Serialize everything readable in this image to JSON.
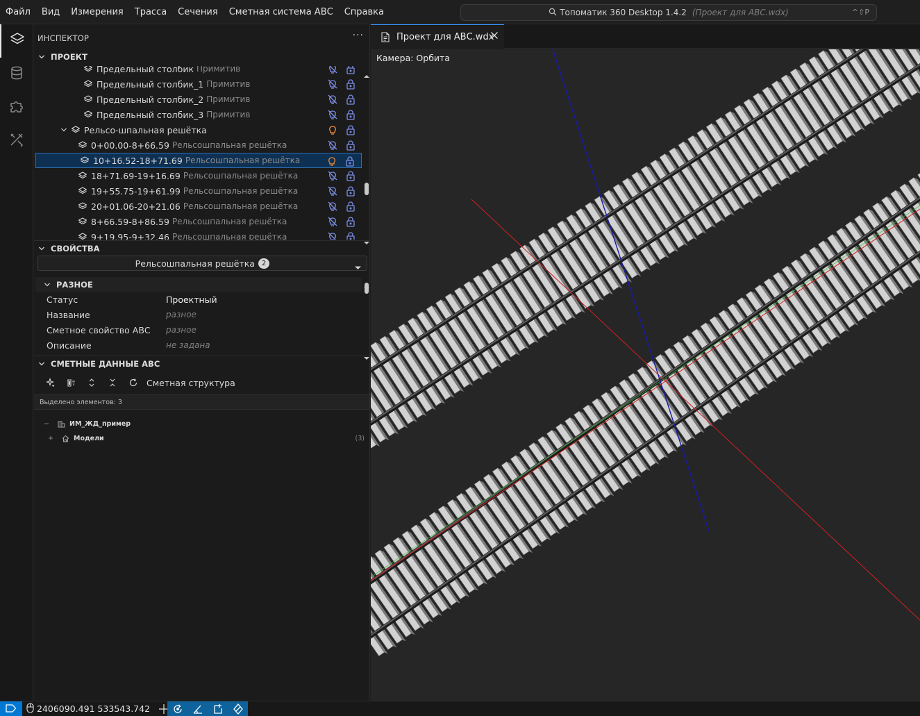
{
  "menu": [
    "Файл",
    "Вид",
    "Измерения",
    "Трасса",
    "Сечения",
    "Сметная система АВС",
    "Справка"
  ],
  "command_center": {
    "title": "Топоматик 360 Desktop 1.4.2",
    "project": "(Проект для АВС.wdx)",
    "shortcut": "^⇧P"
  },
  "activity_icons": [
    "layers-icon",
    "database-icon",
    "puzzle-icon",
    "tools-icon"
  ],
  "sidebar": {
    "title": "ИНСПЕКТОР",
    "more": "···",
    "project_section": "ПРОЕКТ",
    "tree": [
      {
        "name": "Предельный столбик",
        "type": "Примитив",
        "level": 2,
        "vis": "off"
      },
      {
        "name": "Предельный столбик_1",
        "type": "Примитив",
        "level": 2,
        "vis": "off"
      },
      {
        "name": "Предельный столбик_2",
        "type": "Примитив",
        "level": 2,
        "vis": "off"
      },
      {
        "name": "Предельный столбик_3",
        "type": "Примитив",
        "level": 2,
        "vis": "off"
      },
      {
        "name": "Рельсо-шпальная решётка",
        "type": "",
        "level": 1,
        "vis": "on",
        "expanded": true
      },
      {
        "name": "0+00.00-8+66.59",
        "type": "Рельсошпальная решётка",
        "level": 3,
        "vis": "off"
      },
      {
        "name": "10+16.52-18+71.69",
        "type": "Рельсошпальная решётка",
        "level": 3,
        "vis": "on",
        "selected": true
      },
      {
        "name": "18+71.69-19+16.69",
        "type": "Рельсошпальная решётка",
        "level": 3,
        "vis": "off"
      },
      {
        "name": "19+55.75-19+61.99",
        "type": "Рельсошпальная решётка",
        "level": 3,
        "vis": "off"
      },
      {
        "name": "20+01.06-20+21.06",
        "type": "Рельсошпальная решётка",
        "level": 3,
        "vis": "off"
      },
      {
        "name": "8+66.59-8+86.59",
        "type": "Рельсошпальная решётка",
        "level": 3,
        "vis": "off"
      },
      {
        "name": "9+19.95-9+32.46",
        "type": "Рельсошпальная решётка",
        "level": 3,
        "vis": "off"
      }
    ],
    "properties_section": "СВОЙСТВА",
    "properties_combo": {
      "label": "Рельсошпальная решётка",
      "count": "2"
    },
    "misc_section": "РАЗНОЕ",
    "properties": [
      {
        "key": "Статус",
        "value": "Проектный",
        "italic": false
      },
      {
        "key": "Название",
        "value": "разное",
        "italic": true
      },
      {
        "key": "Сметное свойство АВС",
        "value": "разное",
        "italic": true
      },
      {
        "key": "Описание",
        "value": "не задана",
        "italic": true
      }
    ],
    "estimate_section": "СМЕТНЫЕ ДАННЫЕ АВС",
    "estimate_toolbar_label": "Сметная структура",
    "selected_count": "Выделено элементов: 3",
    "estimate_tree": [
      {
        "pm": "−",
        "name": "ИМ_ЖД_пример",
        "count": ""
      },
      {
        "pm": "+",
        "name": "Модели",
        "count": "(3)"
      }
    ]
  },
  "editor": {
    "tab_label": "Проект для АВС.wdx",
    "camera": "Камера: Орбита"
  },
  "statusbar": {
    "coordinates": "2406090.491 533543.742"
  },
  "colors": {
    "accent": "#0078d4",
    "selection_bg": "#0e3052",
    "visible_bulb": "#f28b3b",
    "hidden_icon": "#7d8fe6",
    "axis_x": "#d12020",
    "axis_y": "#30c030",
    "axis_z": "#1a1aa8",
    "sleeper": "#d2d2d2",
    "rail": "#3a3a3a"
  }
}
